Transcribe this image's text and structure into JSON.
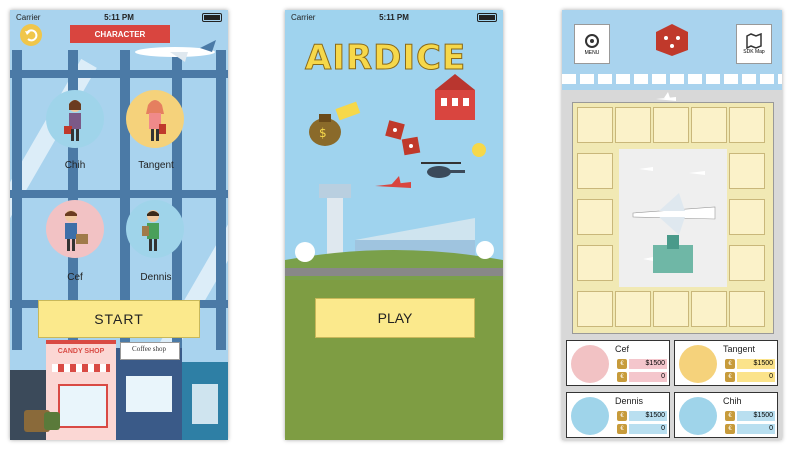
{
  "screen1": {
    "status": {
      "carrier": "Carrier",
      "time": "5:11 PM"
    },
    "header_label": "CHARACTER",
    "characters": [
      {
        "name": "Chih",
        "color": "#9fd4ea"
      },
      {
        "name": "Tangent",
        "color": "#f5d27b"
      },
      {
        "name": "Cef",
        "color": "#f2c2c4"
      },
      {
        "name": "Dennis",
        "color": "#9fd4ea"
      }
    ],
    "start_label": "START",
    "shop_sign": "CANDY SHOP",
    "coffee_sign": "Coffee shop"
  },
  "screen2": {
    "status": {
      "carrier": "Carrier",
      "time": "5:11 PM"
    },
    "title": "AIRDICE",
    "play_label": "PLAY"
  },
  "screen3": {
    "menu_label": "MENU",
    "sdk_label": "SDK Map",
    "players": [
      {
        "name": "Cef",
        "money": "$1500",
        "extra": "0",
        "color": "#f2c2c4"
      },
      {
        "name": "Tangent",
        "money": "$1500",
        "extra": "0",
        "color": "#f5d27b"
      },
      {
        "name": "Dennis",
        "money": "$1500",
        "extra": "0",
        "color": "#9fd4ea"
      },
      {
        "name": "Chih",
        "money": "$1500",
        "extra": "0",
        "color": "#9fd4ea"
      }
    ],
    "coin_symbol": "€"
  }
}
